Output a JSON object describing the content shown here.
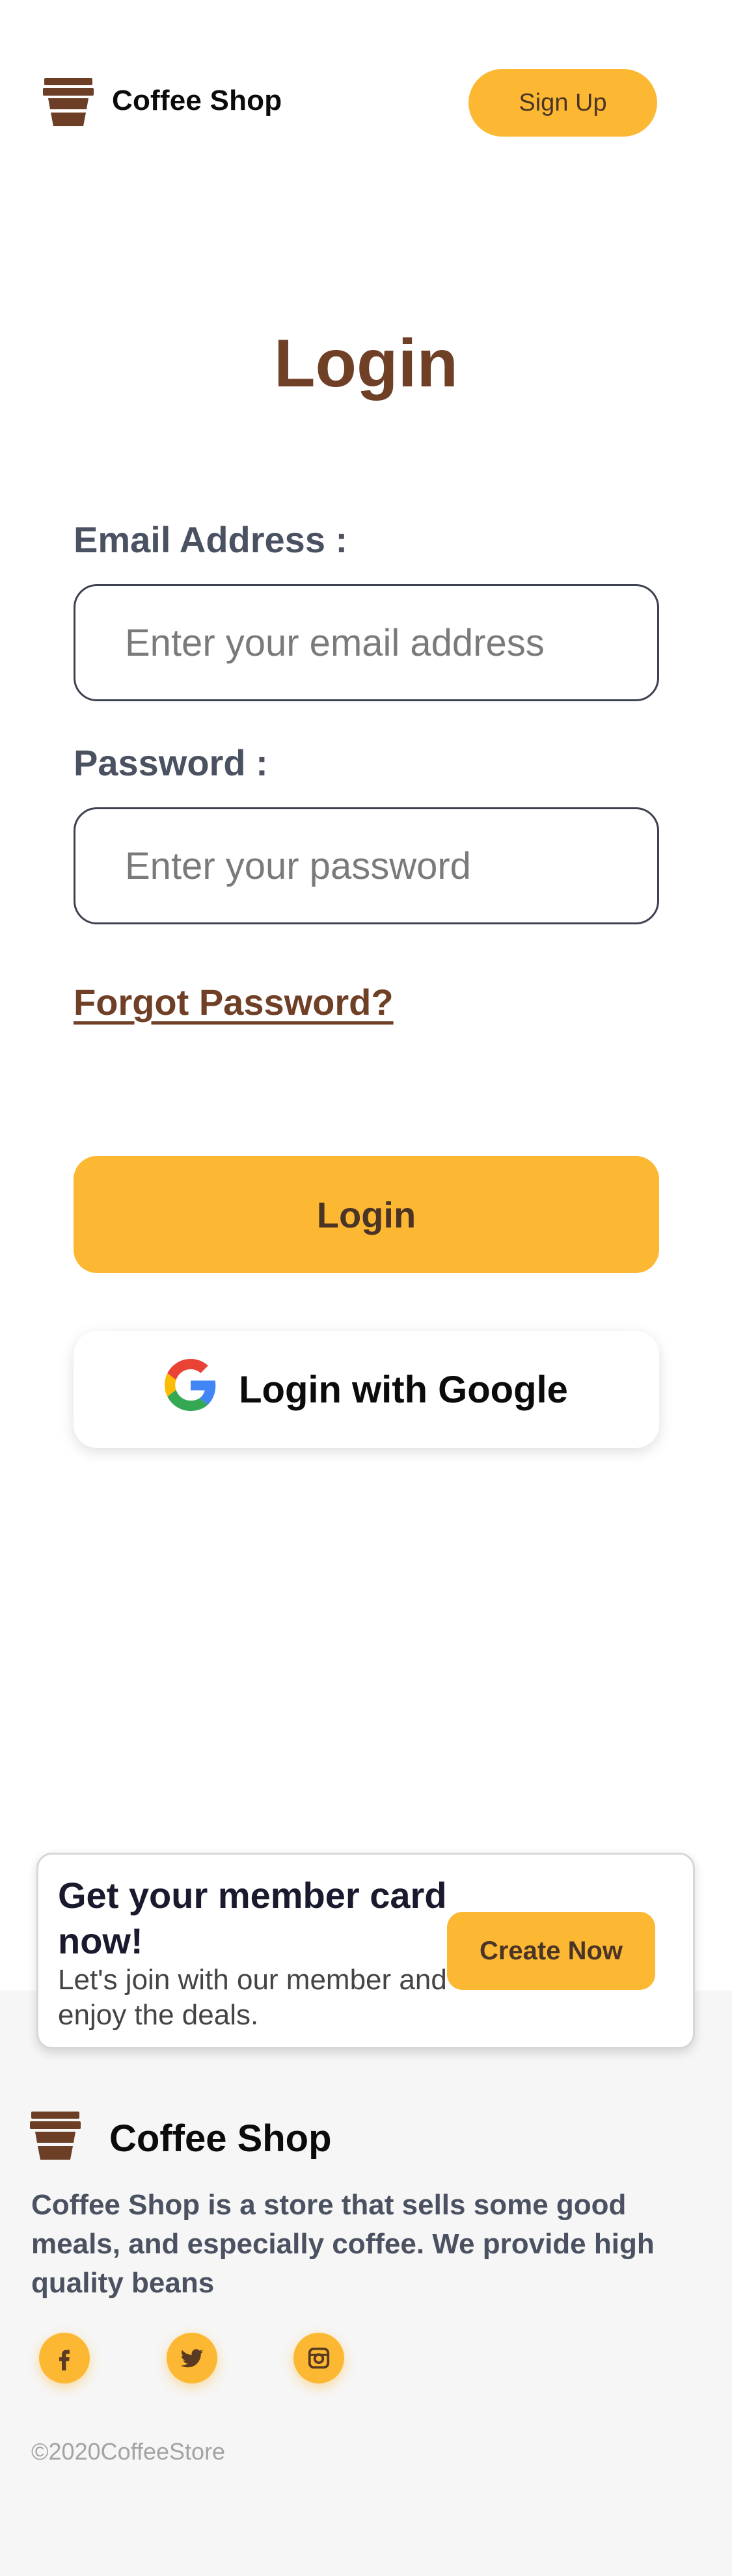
{
  "header": {
    "brand": "Coffee Shop",
    "signup_label": "Sign Up"
  },
  "main": {
    "title": "Login",
    "email_label": "Email Address :",
    "email_placeholder": "Enter your email address",
    "password_label": "Password :",
    "password_placeholder": "Enter your password",
    "forgot_label": "Forgot Password?",
    "login_label": "Login",
    "google_label": "Login with Google"
  },
  "member": {
    "title": "Get your member card now!",
    "subtitle": "Let's join with our member and enjoy the deals.",
    "button_label": "Create Now"
  },
  "footer": {
    "brand": "Coffee Shop",
    "description": "Coffee Shop is a store that sells some good meals, and especially coffee. We provide high quality beans",
    "social": [
      "facebook-icon",
      "twitter-icon",
      "instagram-icon"
    ],
    "copyright": "©2020CoffeeStore"
  },
  "colors": {
    "accent": "#fdb833",
    "brown": "#6f3f26",
    "label_gray": "#4a5160",
    "footer_bg": "#f6f6f6"
  }
}
